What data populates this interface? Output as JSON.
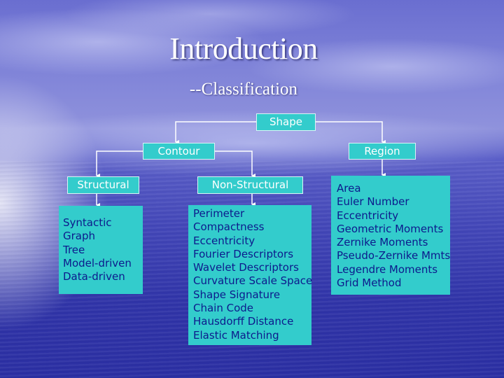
{
  "slide": {
    "title": "Introduction",
    "subtitle": "--Classification"
  },
  "tree": {
    "root": "Shape",
    "contour": "Contour",
    "region": "Region",
    "structural": "Structural",
    "non_structural": "Non-Structural",
    "structural_items": [
      "Syntactic",
      "Graph",
      "Tree",
      "Model-driven",
      "Data-driven"
    ],
    "non_structural_items": [
      "Perimeter",
      "Compactness",
      "Eccentricity",
      "Fourier Descriptors",
      "Wavelet Descriptors",
      "Curvature Scale Space",
      "Shape Signature",
      "Chain Code",
      "Hausdorff Distance",
      "Elastic Matching"
    ],
    "region_items": [
      "Area",
      "Euler Number",
      "Eccentricity",
      "Geometric Moments",
      "Zernike Moments",
      "Pseudo-Zernike Mmts",
      "Legendre Moments",
      "Grid Method"
    ]
  },
  "colors": {
    "node_fill": "#33cccc",
    "node_text": "#ffffff",
    "list_text": "#0d1a8c",
    "connector": "#ffffff"
  }
}
